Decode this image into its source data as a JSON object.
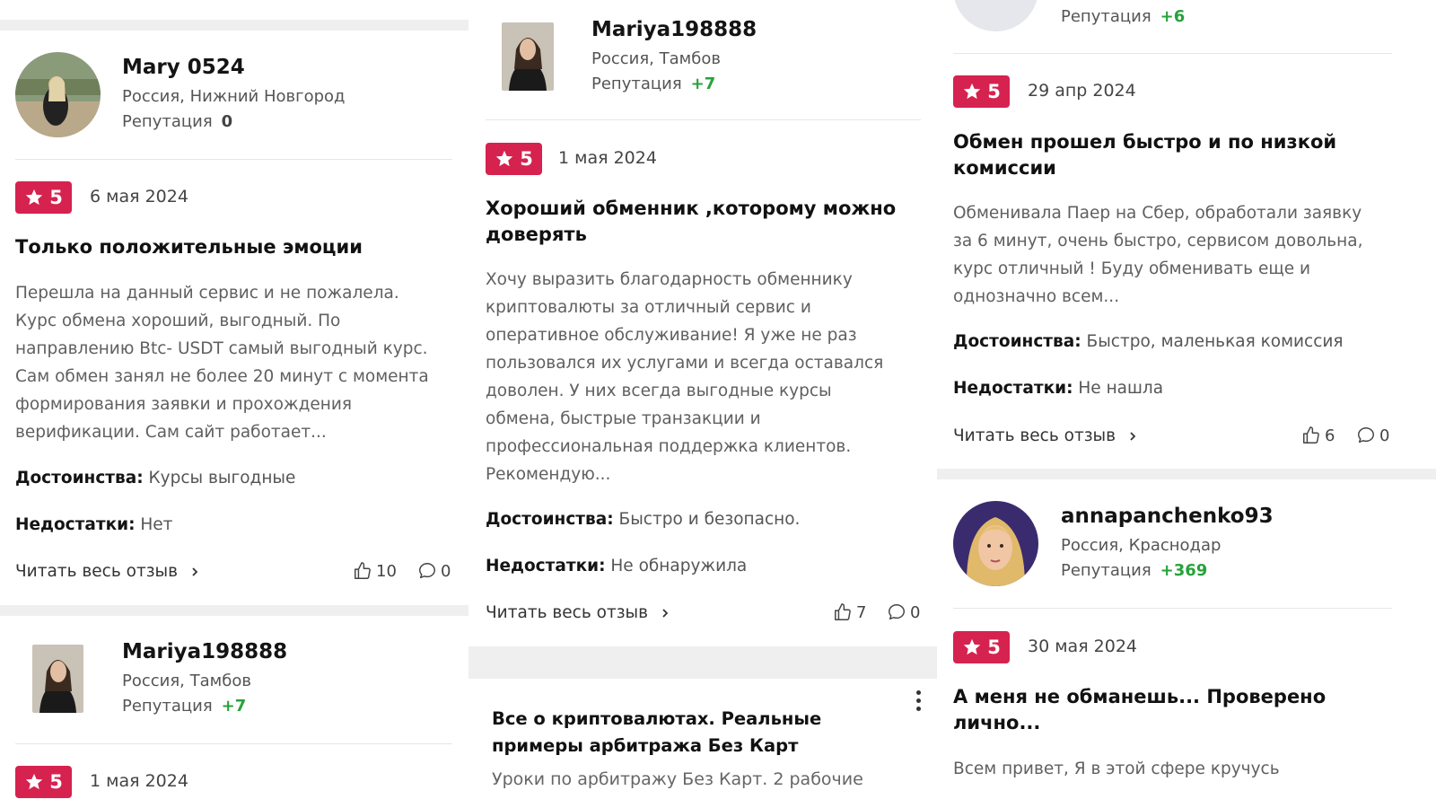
{
  "ui": {
    "read_more": "Читать весь отзыв",
    "pros_label": "Достоинства:",
    "cons_label": "Недостатки:",
    "reputation_label": "Репутация",
    "star_icon": "star-icon",
    "like_icon": "thumbs-up-icon",
    "comment_icon": "comment-icon",
    "accent_color": "#d6224f",
    "positive_color": "#27a23a"
  },
  "col1": {
    "review1": {
      "user": {
        "name": "Mary 0524",
        "location": "Россия, Нижний Новгород",
        "reputation": "0"
      },
      "rating": "5",
      "date": "6 мая 2024",
      "title": "Только положительные эмоции",
      "body": [
        "Перешла на данный сервис и не пожалела.",
        "Курс обмена хороший, выгодный. По",
        "направлению Btc- USDT самый выгодный курс.",
        "Сам обмен занял не более 20 минут с момента",
        "формирования заявки и прохождения",
        "верификации. Сам сайт работает..."
      ],
      "pros": "Курсы выгодные",
      "cons": "Нет",
      "likes": "10",
      "comments": "0"
    },
    "review2": {
      "user": {
        "name": "Mariya198888",
        "location": "Россия, Тамбов",
        "reputation": "+7"
      },
      "rating": "5",
      "date": "1 мая 2024"
    }
  },
  "col2": {
    "review1": {
      "user": {
        "name": "Mariya198888",
        "location": "Россия, Тамбов",
        "reputation": "+7"
      },
      "rating": "5",
      "date": "1 мая 2024",
      "title": [
        "Хороший обменник ,которому можно",
        "доверять"
      ],
      "body": [
        "Хочу выразить благодарность обменнику",
        "криптовалюты за отличный сервис и",
        "оперативное обслуживание! Я уже не раз",
        "пользовался их услугами и всегда оставался",
        "доволен. У них всегда выгодные курсы",
        "обмена, быстрые транзакции и",
        "профессиональная поддержка клиентов.",
        "Рекомендую..."
      ],
      "pros": "Быстро и безопасно.",
      "cons": "Не обнаружила",
      "likes": "7",
      "comments": "0"
    },
    "ad": {
      "title": [
        "Все о криптовалютах. Реальные",
        "примеры арбитража Без Карт"
      ],
      "text": "Уроки по арбитражу Без Карт. 2 рабочие"
    }
  },
  "col3": {
    "top_user": {
      "reputation": "+6"
    },
    "review1": {
      "rating": "5",
      "date": "29 апр 2024",
      "title": [
        "Обмен прошел быстро и по низкой",
        "комиссии"
      ],
      "body": [
        "Обменивала Паер на Сбер, обработали заявку",
        "за 6 минут, очень быстро, сервисом довольна,",
        "курс отличный ! Буду обменивать еще и",
        "однозначно всем..."
      ],
      "pros": "Быстро, маленькая комиссия",
      "cons": "Не нашла",
      "likes": "6",
      "comments": "0"
    },
    "review2": {
      "user": {
        "name": "annapanchenko93",
        "location": "Россия, Краснодар",
        "reputation": "+369"
      },
      "rating": "5",
      "date": "30 мая 2024",
      "title": [
        "А меня не обманешь... Проверено",
        "лично..."
      ],
      "body": "Всем привет, Я в этой сфере кручусь"
    }
  }
}
